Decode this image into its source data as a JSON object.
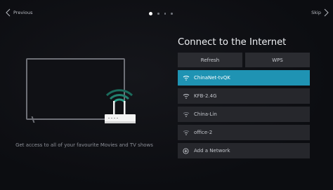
{
  "nav": {
    "previous_label": "Previous",
    "skip_label": "Skip",
    "page_indicator": {
      "total": 4,
      "current": 1
    }
  },
  "illustration": {
    "caption": "Get access to all of your favourite Movies and TV shows"
  },
  "panel": {
    "title": "Connect to the Internet",
    "refresh_label": "Refresh",
    "wps_label": "WPS",
    "networks": [
      {
        "ssid": "ChinaNet-tvQK",
        "selected": true,
        "icon": "wifi-icon"
      },
      {
        "ssid": "KFB-2.4G",
        "selected": false,
        "icon": "wifi-icon"
      },
      {
        "ssid": "China-Lin",
        "selected": false,
        "icon": "wifi-icon"
      },
      {
        "ssid": "office-2",
        "selected": false,
        "icon": "wifi-icon"
      }
    ],
    "add_network_label": "Add a Network",
    "add_network_icon": "plus-circle-icon"
  },
  "colors": {
    "accent": "#1f93b3",
    "background": "#0c0d11",
    "item_bg": "#26272c"
  }
}
